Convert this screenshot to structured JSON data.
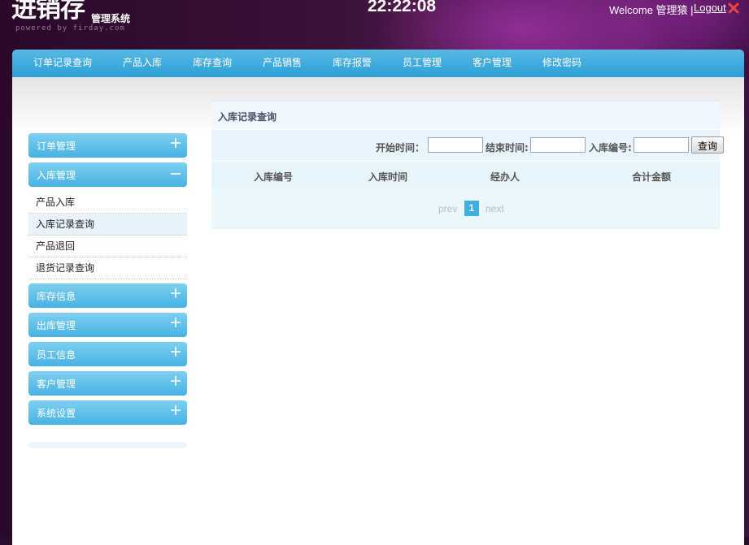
{
  "header": {
    "logo_main": "进销存",
    "logo_sub": "管理系统",
    "powered": "powered  by  firday.com",
    "clock": "22:22:08",
    "welcome": "Welcome 管理猿 |",
    "logout": "Logout"
  },
  "nav": [
    "订单记录查询",
    "产品入库",
    "库存查询",
    "产品销售",
    "库存报警",
    "员工管理",
    "客户管理",
    "修改密码"
  ],
  "sidebar": {
    "sections": [
      {
        "label": "订单管理",
        "state": "collapsed"
      },
      {
        "label": "入库管理",
        "state": "expanded"
      },
      {
        "label": "库存信息",
        "state": "collapsed"
      },
      {
        "label": "出库管理",
        "state": "collapsed"
      },
      {
        "label": "员工信息",
        "state": "collapsed"
      },
      {
        "label": "客户管理",
        "state": "collapsed"
      },
      {
        "label": "系统设置",
        "state": "collapsed"
      }
    ],
    "subitems": [
      "产品入库",
      "入库记录查询",
      "产品退回",
      "退货记录查询"
    ],
    "active_subitem": "入库记录查询"
  },
  "main": {
    "title": "入库记录查询",
    "search": {
      "start_label": "开始时间：",
      "end_label": "结束时间:",
      "code_label": "入库编号:",
      "button": "查询",
      "start_value": "",
      "end_value": "",
      "code_value": ""
    },
    "columns": [
      "入库编号",
      "入库时间",
      "经办人",
      "合计金额"
    ],
    "pager": {
      "prev": "prev",
      "current": "1",
      "next": "next"
    }
  },
  "colors": {
    "accent": "#3faee0",
    "nav": "#2b9fd6",
    "background": "#2a0f2c"
  }
}
